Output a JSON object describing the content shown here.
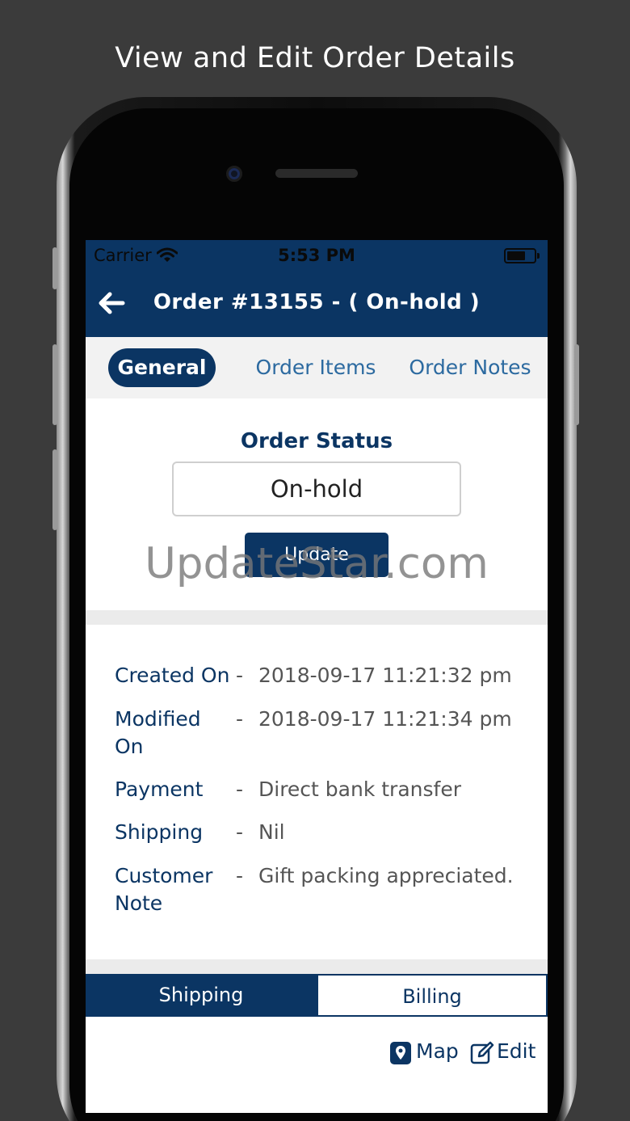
{
  "caption": "View and Edit Order Details",
  "status_bar": {
    "carrier": "Carrier",
    "time": "5:53 PM"
  },
  "header": {
    "title": "Order #13155 - ( On-hold )"
  },
  "tabs": [
    {
      "label": "General"
    },
    {
      "label": "Order Items"
    },
    {
      "label": "Order Notes"
    }
  ],
  "order_status": {
    "label": "Order Status",
    "selected": "On-hold",
    "update_label": "Update"
  },
  "watermark": "UpdateStar.com",
  "details": [
    {
      "label": "Created On",
      "dash": "-",
      "value": "2018-09-17 11:21:32 pm"
    },
    {
      "label": "Modified On",
      "dash": "-",
      "value": "2018-09-17 11:21:34 pm"
    },
    {
      "label": "Payment",
      "dash": "-",
      "value": "Direct bank transfer"
    },
    {
      "label": "Shipping",
      "dash": "-",
      "value": "Nil"
    },
    {
      "label": "Customer Note",
      "dash": "-",
      "value": "Gift packing appreciated."
    }
  ],
  "address_tabs": [
    {
      "label": "Shipping"
    },
    {
      "label": "Billing"
    }
  ],
  "actions": {
    "map_label": "Map",
    "edit_label": "Edit"
  },
  "colors": {
    "primary": "#0b3563",
    "link": "#2c6aa0",
    "background": "#3b3b3b"
  }
}
